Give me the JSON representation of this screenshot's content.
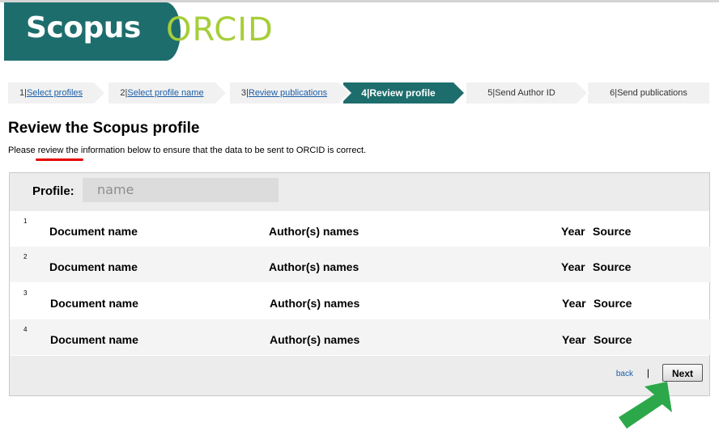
{
  "header": {
    "scopus_logo_text": "Scopus",
    "orcid_logo_text": "ORCID"
  },
  "steps": [
    {
      "number": "1",
      "label": "Select profiles",
      "link": true,
      "active": false
    },
    {
      "number": "2",
      "label": "Select profile name",
      "link": true,
      "active": false
    },
    {
      "number": "3",
      "label": "Review publications",
      "link": true,
      "active": false
    },
    {
      "number": "4",
      "label": "Review profile",
      "link": false,
      "active": true
    },
    {
      "number": "5",
      "label": "Send Author ID",
      "link": false,
      "active": false
    },
    {
      "number": "6",
      "label": "Send publications",
      "link": false,
      "active": false
    }
  ],
  "page": {
    "title": "Review the Scopus profile",
    "intro": "Please review the information below to ensure that the data to be sent to ORCID is correct."
  },
  "profile": {
    "label": "Profile:",
    "name": "name"
  },
  "rows": [
    {
      "num": "1",
      "document": "Document name",
      "authors": "Author(s) names",
      "year": "Year",
      "source": "Source"
    },
    {
      "num": "2",
      "document": "Document name",
      "authors": "Author(s) names",
      "year": "Year",
      "source": "Source"
    },
    {
      "num": "3",
      "document": "Document name",
      "authors": "Author(s) names",
      "year": "Year",
      "source": "Source"
    },
    {
      "num": "4",
      "document": "Document name",
      "authors": "Author(s) names",
      "year": "Year",
      "source": "Source"
    }
  ],
  "footer": {
    "back_label": "back",
    "separator": "|",
    "next_label": "Next"
  },
  "colors": {
    "scopus_teal": "#1e6d6d",
    "orcid_green": "#a6ce39",
    "link_blue": "#1a5ea8",
    "highlight_red": "#e60000",
    "arrow_green": "#2ca84a"
  }
}
